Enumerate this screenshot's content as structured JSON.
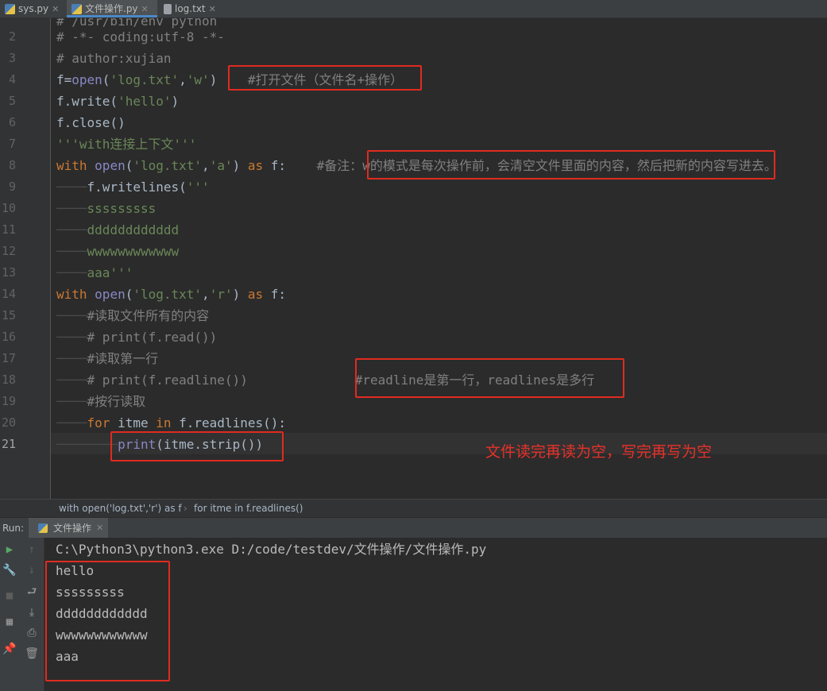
{
  "tabs": [
    {
      "label": "sys.py",
      "icon": "python-file-icon",
      "active": false
    },
    {
      "label": "文件操作.py",
      "icon": "python-file-icon",
      "active": true
    },
    {
      "label": "log.txt",
      "icon": "text-file-icon",
      "active": false
    }
  ],
  "editor": {
    "line_numbers": [
      "2",
      "3",
      "4",
      "5",
      "6",
      "7",
      "8",
      "9",
      "10",
      "11",
      "12",
      "13",
      "14",
      "15",
      "16",
      "17",
      "18",
      "19",
      "20",
      "21"
    ],
    "current_line": "21",
    "top_partial": "# /usr/bin/env python",
    "lines": [
      "# -*- coding:utf-8 -*-",
      "# author:xujian",
      [
        "f=",
        "open",
        "(",
        "'log.txt'",
        ",",
        "'w'",
        ")",
        "    #打开文件（文件名+操作）"
      ],
      [
        "f.write(",
        "'hello'",
        ")"
      ],
      "f.close()",
      "'''with连接上下文'''",
      [
        "with",
        " ",
        "open",
        "(",
        "'log.txt'",
        ",",
        "'a'",
        ") ",
        "as",
        " f:",
        "    #备注：w的模式是每次操作前，会清空文件里面的内容，然后把新的内容写进去。"
      ],
      [
        "f.writelines(",
        "'''"
      ],
      "sssssssss",
      "dddddddddddd",
      "wwwwwwwwwwww",
      "aaa'''",
      [
        "with",
        " ",
        "open",
        "(",
        "'log.txt'",
        ",",
        "'r'",
        ") ",
        "as",
        " f:"
      ],
      "#读取文件所有的内容",
      "# print(f.read())",
      "#读取第一行",
      [
        "# print(f.readline())",
        "              #readline是第一行，readlines是多行"
      ],
      "#按行读取",
      [
        "for",
        " itme ",
        "in",
        " f.readlines():"
      ],
      [
        "print",
        "(itme.strip())"
      ]
    ]
  },
  "annotation": "文件读完再读为空，写完再写为空",
  "breadcrumb": [
    "with open('log.txt','r') as f",
    "for itme in f.readlines()"
  ],
  "run": {
    "label": "Run:",
    "tab_label": "文件操作",
    "command": "C:\\Python3\\python3.exe D:/code/testdev/文件操作/文件操作.py",
    "output": [
      "hello",
      "sssssssss",
      "dddddddddddd",
      "wwwwwwwwwwww",
      "aaa"
    ]
  },
  "colors": {
    "highlight": "#e02b20",
    "keyword": "#cc7832",
    "string": "#6a8759",
    "comment": "#808080",
    "builtin": "#8888c6"
  }
}
